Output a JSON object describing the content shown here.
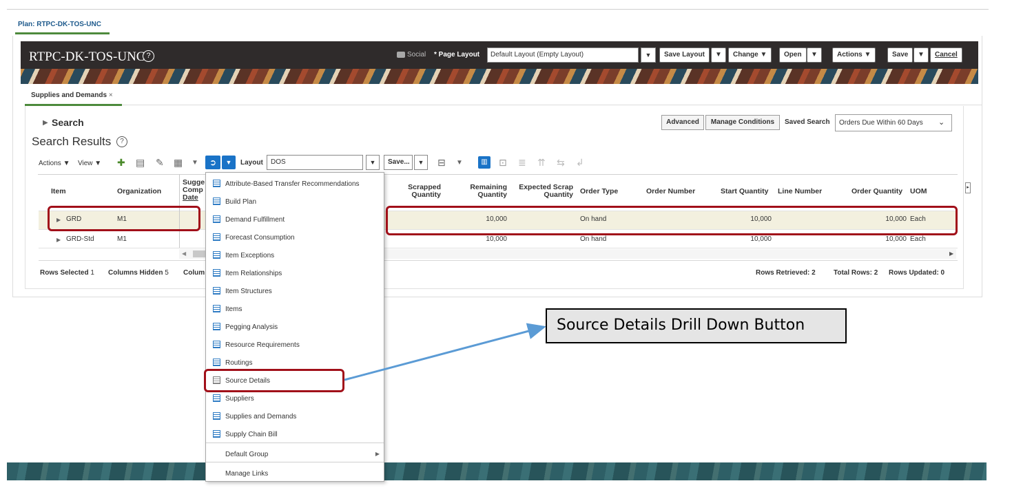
{
  "plan_tab": "Plan: RTPC-DK-TOS-UNC",
  "header": {
    "title": "RTPC-DK-TOS-UNC",
    "help": "?",
    "social": "Social",
    "page_layout_label": "* Page Layout",
    "page_layout_value": "Default Layout (Empty Layout)",
    "save_layout": "Save Layout",
    "change": "Change",
    "open": "Open",
    "actions": "Actions",
    "save": "Save",
    "cancel": "Cancel"
  },
  "work_tab": {
    "label": "Supplies and Demands",
    "close": "×"
  },
  "search": {
    "label": "Search",
    "advanced": "Advanced",
    "manage_conditions": "Manage Conditions",
    "saved_search_label": "Saved Search",
    "saved_search_value": "Orders Due Within 60 Days"
  },
  "results": {
    "title": "Search Results",
    "help": "?",
    "actions": "Actions",
    "view": "View",
    "layout_label": "Layout",
    "layout_value": "DOS",
    "save": "Save..."
  },
  "table": {
    "headers": {
      "item": "Item",
      "organization": "Organization",
      "sugg1": "Sugge",
      "sugg2": "Comp",
      "sugg3": "Date",
      "scrapped1": "Scrapped",
      "scrapped2": "Quantity",
      "remaining1": "Remaining",
      "remaining2": "Quantity",
      "expscrap1": "Expected Scrap",
      "expscrap2": "Quantity",
      "order_type": "Order Type",
      "order_number": "Order Number",
      "start_qty": "Start Quantity",
      "line_number": "Line Number",
      "order_qty": "Order Quantity",
      "uom": "UOM"
    },
    "rows": [
      {
        "item": "GRD",
        "org": "M1",
        "remaining": "10,000",
        "order_type": "On hand",
        "start_qty": "10,000",
        "order_qty": "10,000",
        "uom": "Each"
      },
      {
        "item": "GRD-Std",
        "org": "M1",
        "remaining": "10,000",
        "order_type": "On hand",
        "start_qty": "10,000",
        "order_qty": "10,000",
        "uom": "Each"
      }
    ]
  },
  "footer": {
    "rows_selected_label": "Rows Selected",
    "rows_selected": "1",
    "columns_hidden_label": "Columns Hidden",
    "columns_hidden": "5",
    "colum": "Colum",
    "rows_retrieved": "Rows Retrieved: 2",
    "total_rows": "Total Rows: 2",
    "rows_updated": "Rows Updated: 0"
  },
  "menu": {
    "items": [
      "Attribute-Based Transfer Recommendations",
      "Build Plan",
      "Demand Fulfillment",
      "Forecast Consumption",
      "Item Exceptions",
      "Item Relationships",
      "Item Structures",
      "Items",
      "Pegging Analysis",
      "Resource Requirements",
      "Routings",
      "Source Details",
      "Suppliers",
      "Supplies and Demands",
      "Supply Chain Bill"
    ],
    "default_group": "Default Group",
    "manage_links": "Manage Links"
  },
  "callout": "Source Details Drill Down Button",
  "colors": {
    "highlight": "#a10f19",
    "arrow": "#5b9bd5",
    "accent": "#1a73c7",
    "tab_underline": "#4d8a3c"
  }
}
